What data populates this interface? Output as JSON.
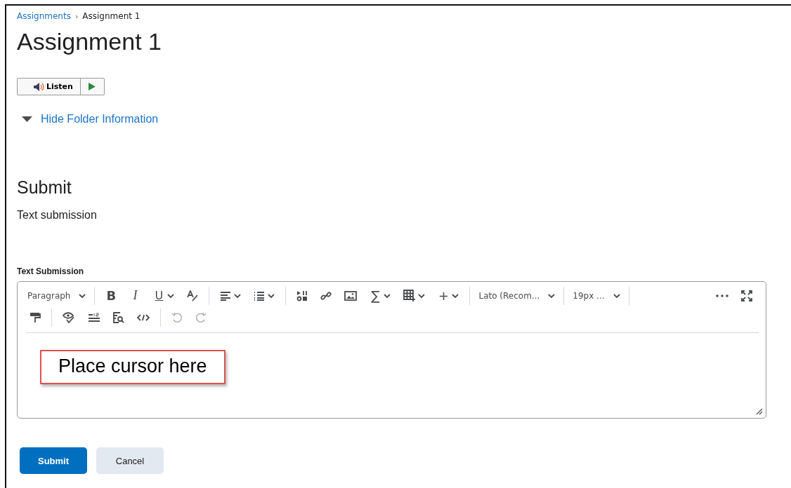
{
  "breadcrumb": {
    "link": "Assignments",
    "separator": "›",
    "current": "Assignment 1"
  },
  "title": "Assignment 1",
  "listen_button": {
    "label": "Listen"
  },
  "folder_toggle": {
    "label": "Hide Folder Information",
    "expanded": true
  },
  "section_heading": "Submit",
  "section_text": "Text submission",
  "editor": {
    "label": "Text Submission",
    "toolbar_rows": [
      [
        {
          "kind": "dropdown",
          "label": "Paragraph"
        },
        {
          "kind": "sep"
        },
        {
          "kind": "glyph",
          "text": "B",
          "has_menu": false
        },
        {
          "kind": "glyph",
          "text": "I",
          "has_menu": false
        },
        {
          "kind": "glyph",
          "text": "U",
          "has_menu": true
        },
        {
          "kind": "icon",
          "has_menu": false
        },
        {
          "kind": "sep"
        },
        {
          "kind": "icon",
          "has_menu": true
        },
        {
          "kind": "icon",
          "has_menu": true
        },
        {
          "kind": "sep"
        },
        {
          "kind": "icon",
          "has_menu": false
        },
        {
          "kind": "icon",
          "has_menu": false
        },
        {
          "kind": "icon",
          "has_menu": false
        },
        {
          "kind": "glyph",
          "text": "∑",
          "has_menu": true
        },
        {
          "kind": "icon",
          "has_menu": true
        },
        {
          "kind": "glyph",
          "text": "+",
          "has_menu": true
        },
        {
          "kind": "sep"
        },
        {
          "kind": "dropdown",
          "label": "Lato (Recom..."
        },
        {
          "kind": "sep"
        },
        {
          "kind": "dropdown",
          "label": "19px ..."
        },
        {
          "kind": "sep"
        },
        {
          "kind": "spacer"
        },
        {
          "kind": "icon",
          "has_menu": false
        },
        {
          "kind": "icon",
          "has_menu": false
        }
      ],
      [
        {
          "kind": "icon",
          "has_menu": false
        },
        {
          "kind": "sep"
        },
        {
          "kind": "icon",
          "has_menu": false
        },
        {
          "kind": "icon",
          "has_menu": false
        },
        {
          "kind": "icon",
          "has_menu": false
        },
        {
          "kind": "icon",
          "has_menu": false
        },
        {
          "kind": "sep"
        },
        {
          "kind": "icon",
          "has_menu": false
        },
        {
          "kind": "icon",
          "has_menu": false
        }
      ]
    ],
    "callout": "Place cursor here"
  },
  "buttons": [
    {
      "label": "Submit",
      "kind": "primary"
    },
    {
      "label": "Cancel",
      "kind": "secondary"
    }
  ]
}
